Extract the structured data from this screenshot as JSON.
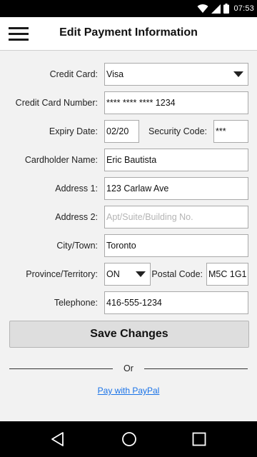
{
  "status_bar": {
    "time": "07:53"
  },
  "app_bar": {
    "title": "Edit Payment Information"
  },
  "form": {
    "credit_card": {
      "label": "Credit Card:",
      "value": "Visa"
    },
    "card_number": {
      "label": "Credit Card Number:",
      "value": "**** **** **** 1234"
    },
    "expiry": {
      "label": "Expiry Date:",
      "value": "02/20"
    },
    "security_code": {
      "label": "Security Code:",
      "value": "***"
    },
    "cardholder": {
      "label": "Cardholder Name:",
      "value": "Eric Bautista"
    },
    "address1": {
      "label": "Address 1:",
      "value": "123 Carlaw Ave"
    },
    "address2": {
      "label": "Address 2:",
      "placeholder": "Apt/Suite/Building No."
    },
    "city": {
      "label": "City/Town:",
      "value": "Toronto"
    },
    "province": {
      "label": "Province/Territory:",
      "value": "ON"
    },
    "postal": {
      "label": "Postal Code:",
      "value": "M5C 1G1"
    },
    "telephone": {
      "label": "Telephone:",
      "value": "416-555-1234"
    }
  },
  "actions": {
    "save_label": "Save Changes",
    "or_label": "Or",
    "paypal_label": "Pay with PayPal"
  },
  "colors": {
    "link": "#1a73e8",
    "button_bg": "#dedede",
    "content_bg": "#f2f2f2"
  },
  "icons": [
    "wifi-icon",
    "signal-icon",
    "battery-icon",
    "menu-icon",
    "dropdown-caret-icon",
    "back-icon",
    "home-icon",
    "recents-icon"
  ]
}
